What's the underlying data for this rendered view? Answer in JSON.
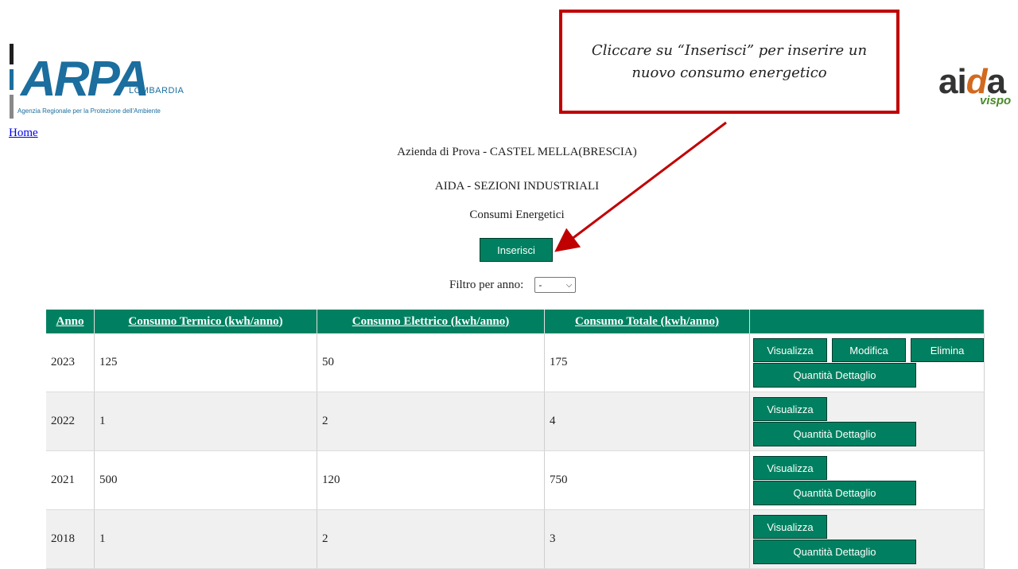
{
  "branding": {
    "arpa_word": "ARPA",
    "arpa_region": "LOMBARDIA",
    "arpa_tagline": "Agenzia Regionale per la Protezione dell'Ambiente",
    "aida_word_a": "ai",
    "aida_word_d": "d",
    "aida_word_e": "a",
    "aida_sub": "vispo"
  },
  "nav": {
    "home": "Home"
  },
  "annotation": {
    "text": "Cliccare su “Inserisci” per inserire un nuovo consumo energetico",
    "color": "#c00000"
  },
  "header": {
    "company": "Azienda di Prova - CASTEL MELLA(BRESCIA)",
    "section": "AIDA - SEZIONI INDUSTRIALI",
    "subsection": "Consumi Energetici"
  },
  "insert_button": "Inserisci",
  "filter": {
    "label": "Filtro per anno:",
    "selected": "-"
  },
  "table": {
    "headers": [
      "Anno",
      "Consumo Termico (kwh/anno)",
      "Consumo Elettrico (kwh/anno)",
      "Consumo Totale (kwh/anno)",
      ""
    ],
    "actions": {
      "view": "Visualizza",
      "edit": "Modifica",
      "delete": "Elimina",
      "detail": "Quantità Dettaglio"
    },
    "rows": [
      {
        "anno": "2023",
        "termico": "125",
        "elettrico": "50",
        "totale": "175"
      },
      {
        "anno": "2022",
        "termico": "1",
        "elettrico": "2",
        "totale": "4"
      },
      {
        "anno": "2021",
        "termico": "500",
        "elettrico": "120",
        "totale": "750"
      },
      {
        "anno": "2018",
        "termico": "1",
        "elettrico": "2",
        "totale": "3"
      }
    ]
  },
  "colors": {
    "primary_green": "#008060",
    "arpa_blue": "#1b6e9e"
  }
}
